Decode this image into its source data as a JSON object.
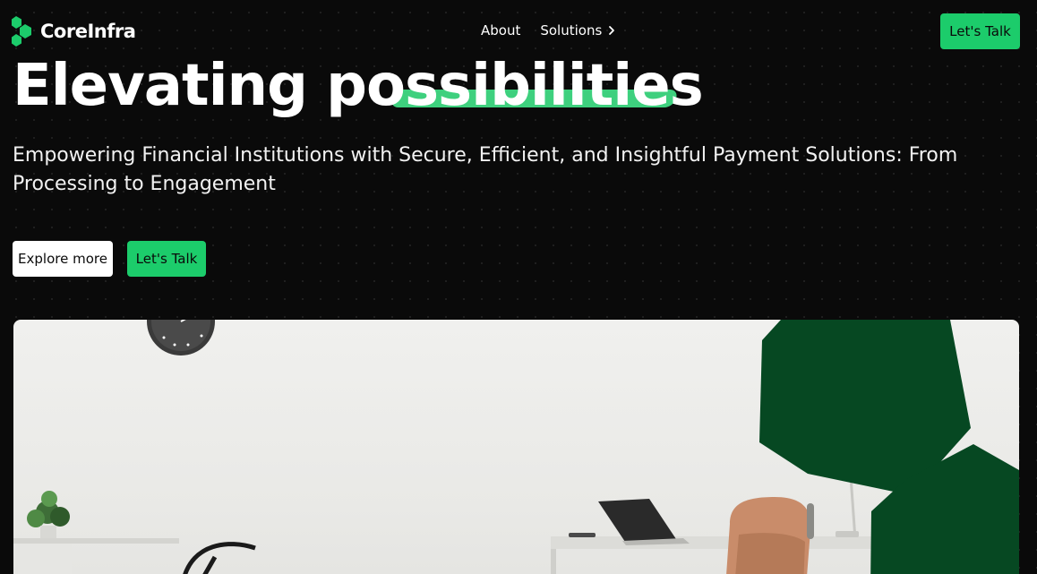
{
  "brand": {
    "name": "CoreInfra",
    "logo_icon": "hexagon-chain-logo-icon",
    "accent": "#1ccc6b"
  },
  "nav": {
    "items": [
      {
        "label": "About"
      },
      {
        "label": "Solutions",
        "icon": "chevron-right-icon"
      }
    ],
    "cta_label": "Let's Talk"
  },
  "hero": {
    "title_word1": "Elevating",
    "title_word2": "possibilities",
    "subtitle": "Empowering Financial Institutions with Secure, Efficient, and Insightful Payment Solutions: From Processing to Engagement",
    "explore_label": "Explore more",
    "cta_label": "Let's Talk",
    "highlight_color": "#3ed07e",
    "hexagon_color": "#064822"
  }
}
